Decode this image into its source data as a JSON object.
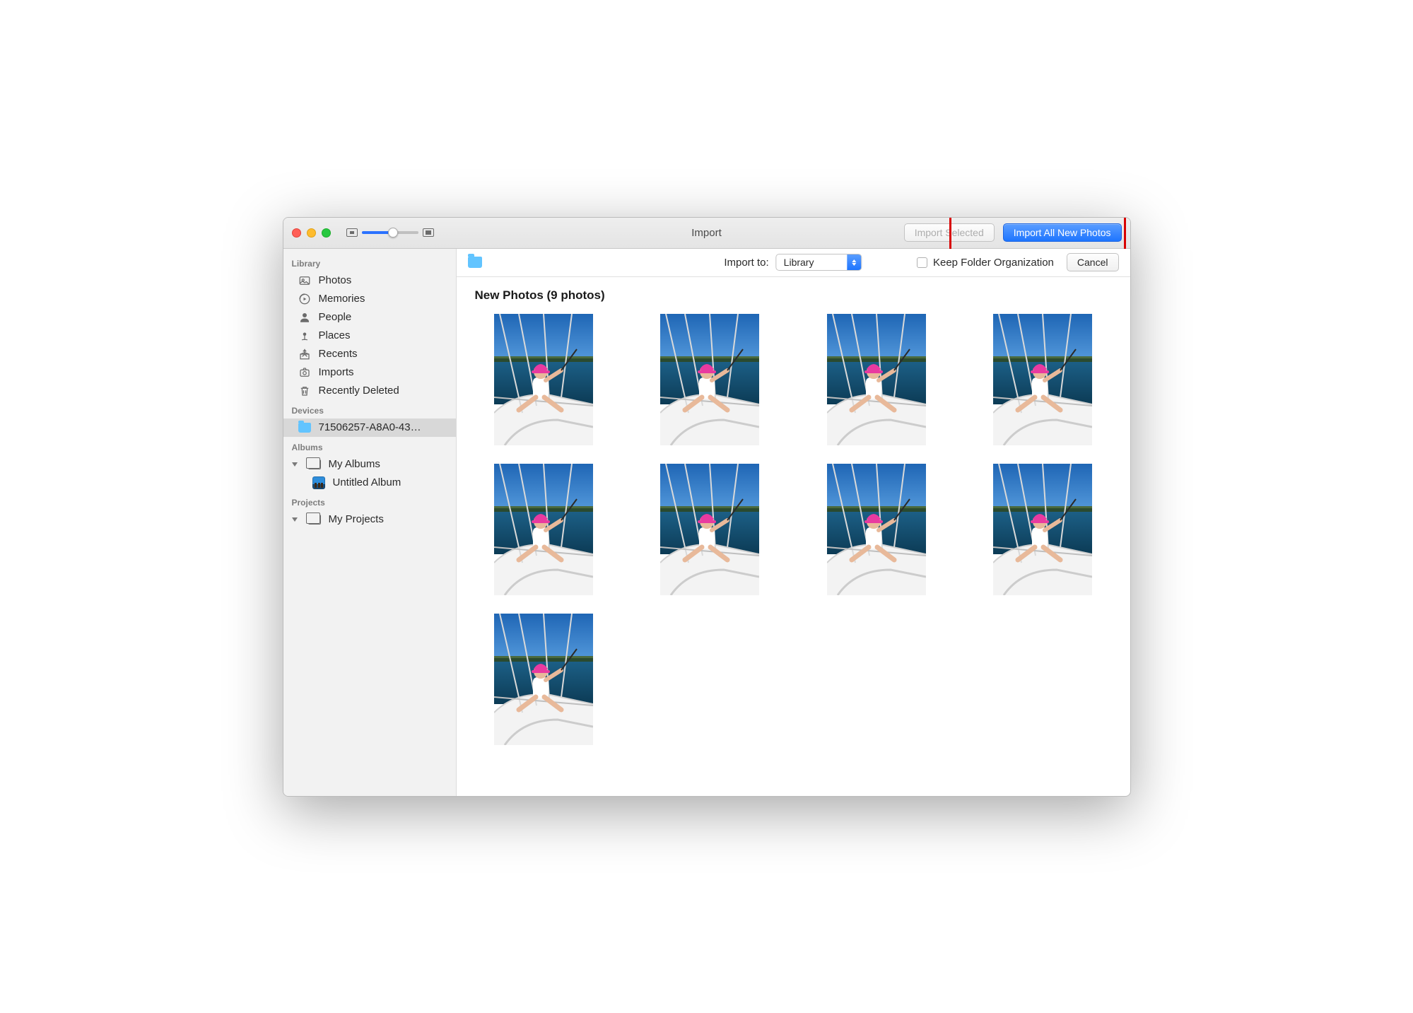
{
  "window": {
    "title": "Import"
  },
  "toolbar": {
    "import_selected_label": "Import Selected",
    "import_all_label": "Import All New Photos"
  },
  "importbar": {
    "import_to_label": "Import to:",
    "import_to_value": "Library",
    "keep_folder_label": "Keep Folder Organization",
    "cancel_label": "Cancel"
  },
  "sidebar": {
    "library_header": "Library",
    "library_items": [
      {
        "label": "Photos",
        "icon": "photos"
      },
      {
        "label": "Memories",
        "icon": "memories"
      },
      {
        "label": "People",
        "icon": "people"
      },
      {
        "label": "Places",
        "icon": "places"
      },
      {
        "label": "Recents",
        "icon": "recents"
      },
      {
        "label": "Imports",
        "icon": "imports"
      },
      {
        "label": "Recently Deleted",
        "icon": "trash"
      }
    ],
    "devices_header": "Devices",
    "devices": [
      {
        "label": "71506257-A8A0-43…",
        "selected": true
      }
    ],
    "albums_header": "Albums",
    "albums_root": "My Albums",
    "albums": [
      {
        "label": "Untitled Album"
      }
    ],
    "projects_header": "Projects",
    "projects_root": "My Projects"
  },
  "main": {
    "section_title": "New Photos (9 photos)",
    "photo_count": 9
  }
}
